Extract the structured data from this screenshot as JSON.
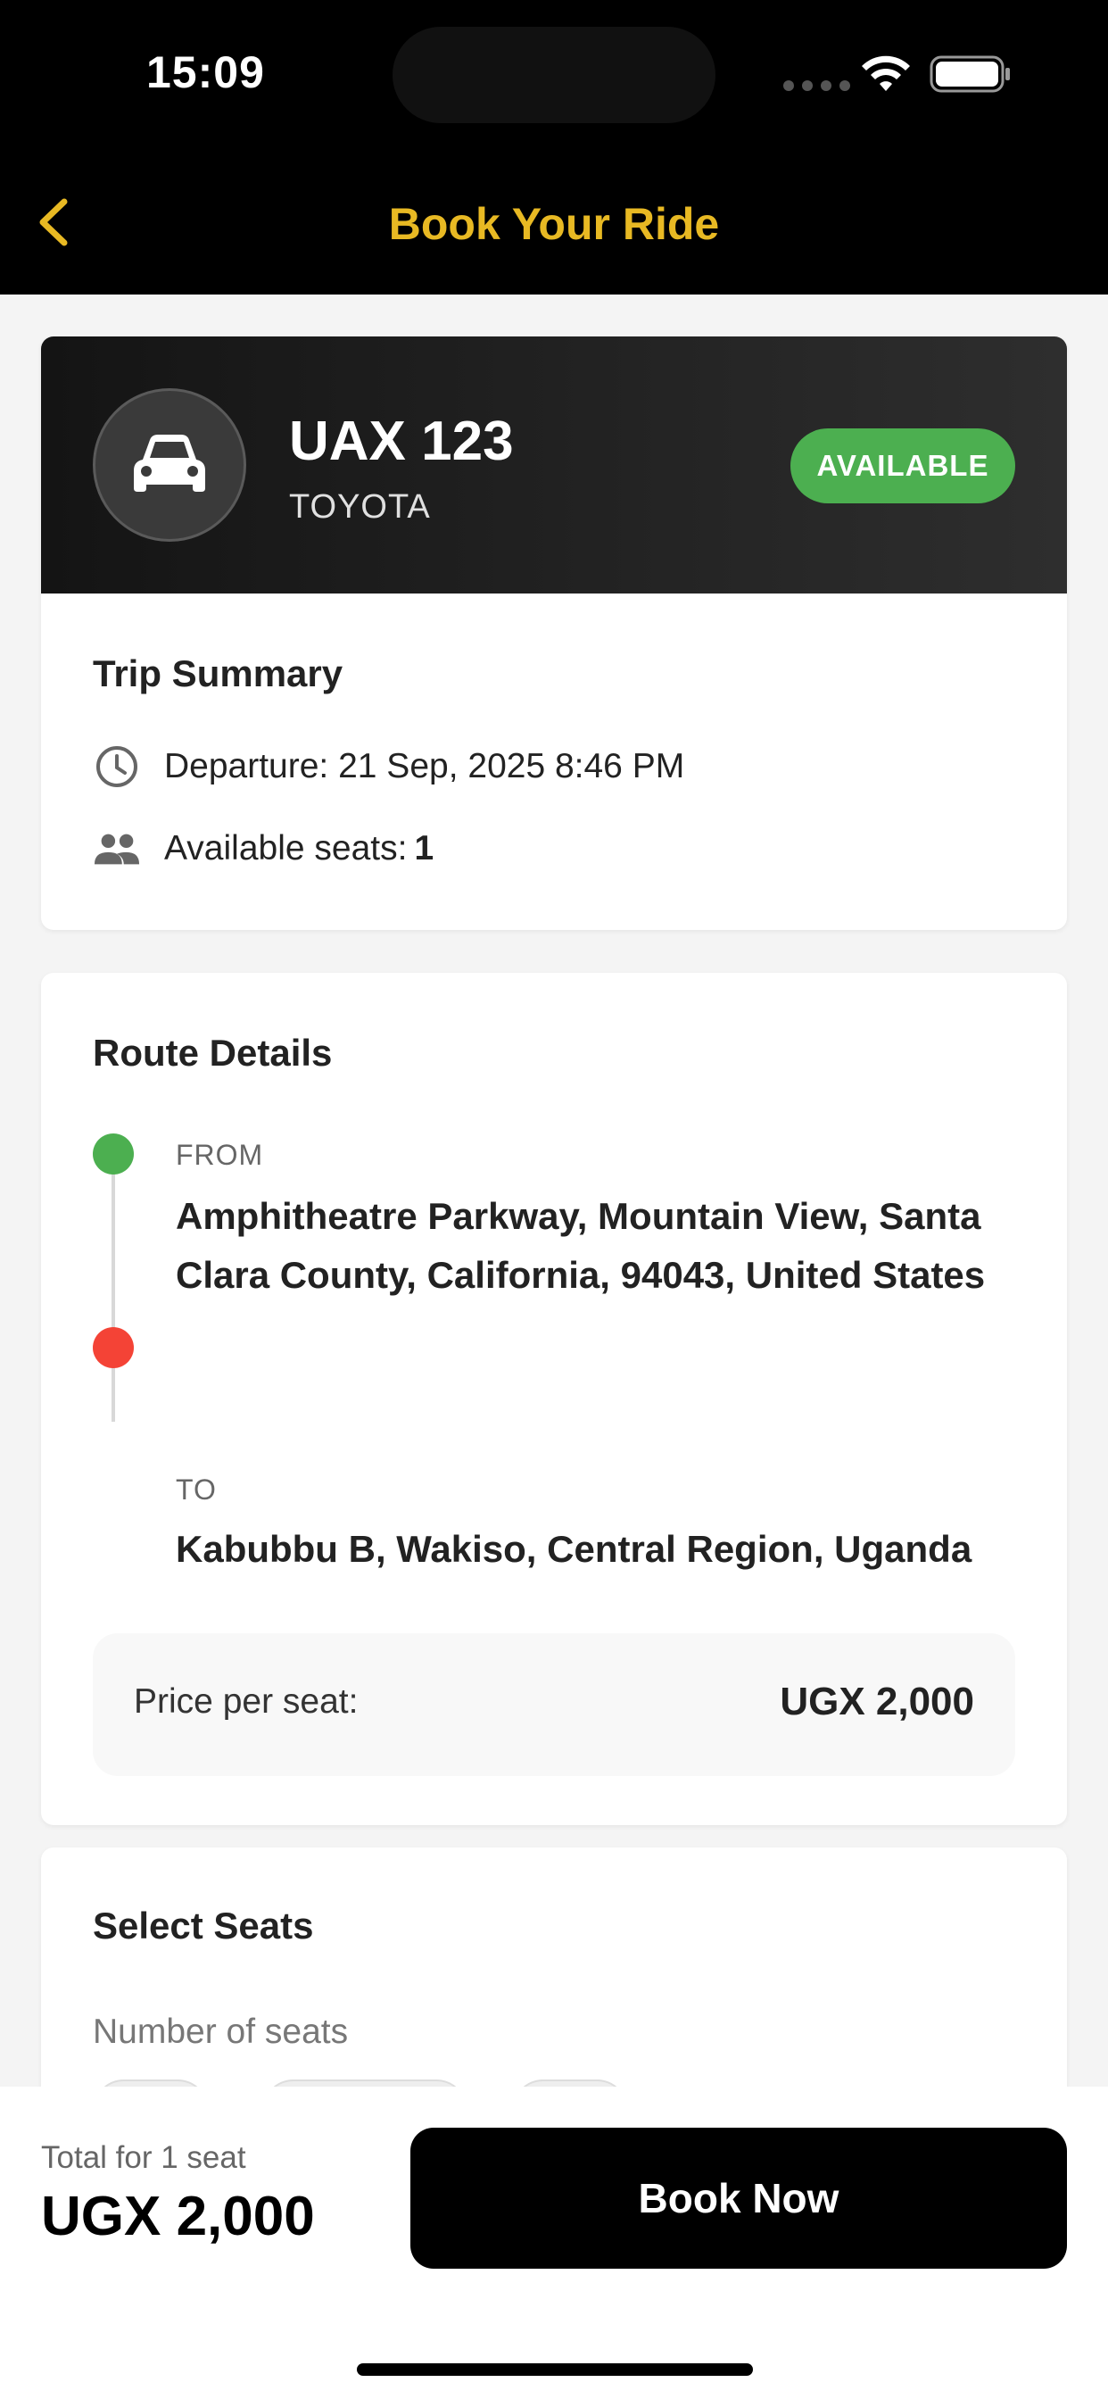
{
  "status_bar": {
    "time": "15:09"
  },
  "header": {
    "title": "Book Your Ride"
  },
  "vehicle": {
    "plate": "UAX 123",
    "make": "TOYOTA",
    "status": "AVAILABLE",
    "status_color": "#4caf50"
  },
  "trip_summary": {
    "title": "Trip Summary",
    "departure": "Departure: 21 Sep, 2025 8:46 PM",
    "seats_label": "Available seats:",
    "seats_value": "1"
  },
  "route": {
    "title": "Route Details",
    "from_label": "FROM",
    "from_address": "Amphitheatre Parkway, Mountain View, Santa Clara County, California, 94043, United States",
    "to_label": "TO",
    "to_address": "Kabubbu B, Wakiso, Central Region, Uganda",
    "price_label": "Price per seat:",
    "price_value": "UGX 2,000",
    "from_color": "#4caf50",
    "to_color": "#f44336"
  },
  "select_seats": {
    "title": "Select Seats",
    "subtitle": "Number of seats"
  },
  "footer": {
    "total_label": "Total for 1 seat",
    "total_value": "UGX 2,000",
    "book_button": "Book Now"
  },
  "colors": {
    "accent": "#e8b923",
    "header_bg": "#000000"
  }
}
